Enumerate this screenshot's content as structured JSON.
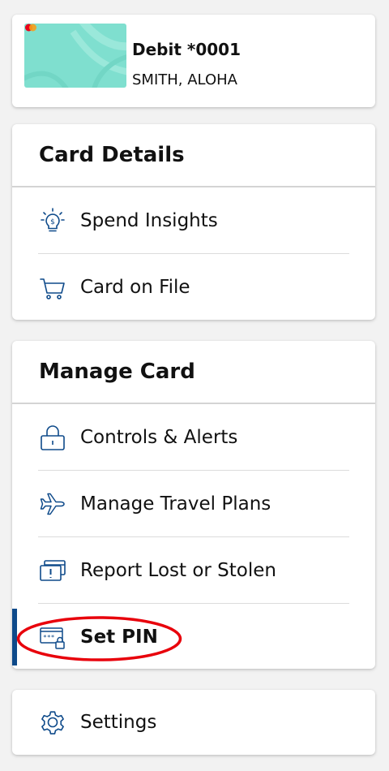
{
  "account": {
    "name": "Debit *0001",
    "holder": "SMITH, ALOHA"
  },
  "card_details": {
    "title": "Card Details",
    "items": [
      {
        "label": "Spend Insights",
        "icon": "lightbulb-dollar-icon"
      },
      {
        "label": "Card on File",
        "icon": "shopping-cart-icon"
      }
    ]
  },
  "manage_card": {
    "title": "Manage Card",
    "items": [
      {
        "label": "Controls & Alerts",
        "icon": "lock-icon"
      },
      {
        "label": "Manage Travel Plans",
        "icon": "airplane-icon"
      },
      {
        "label": "Report Lost or Stolen",
        "icon": "card-alert-icon"
      },
      {
        "label": "Set PIN",
        "icon": "pin-lock-icon",
        "active": true
      }
    ]
  },
  "settings": {
    "label": "Settings",
    "icon": "gear-icon"
  },
  "colors": {
    "icon_blue": "#0e4a8a",
    "active_bar": "#0e4a8a",
    "annotation_red": "#e8000b",
    "card_teal": "#7fdfcf"
  }
}
